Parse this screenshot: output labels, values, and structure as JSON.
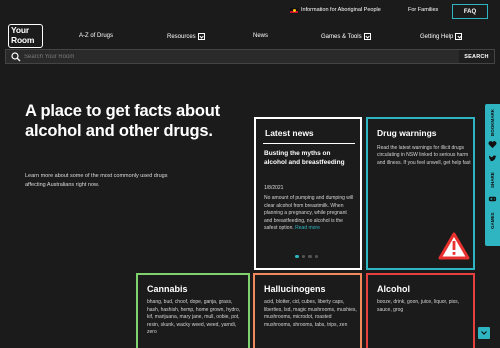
{
  "topbar": {
    "aboriginal_link": "Information for Aboriginal People",
    "families_link": "For Families",
    "faq_label": "FAQ"
  },
  "logo": {
    "line1": "Your",
    "line2": "Room"
  },
  "nav": {
    "items": [
      {
        "label": "A-Z of Drugs",
        "has_dropdown": false
      },
      {
        "label": "Resources",
        "has_dropdown": true
      },
      {
        "label": "News",
        "has_dropdown": false
      },
      {
        "label": "Games & Tools",
        "has_dropdown": true
      },
      {
        "label": "Getting Help",
        "has_dropdown": true
      }
    ]
  },
  "search": {
    "placeholder": "Search Your Room",
    "button_label": "SEARCH",
    "value": ""
  },
  "hero": {
    "title": "A place to get facts about alcohol and other drugs.",
    "subtitle": "Learn more about some of the most commonly used drugs affecting Australians right now."
  },
  "latest_news": {
    "title": "Latest news",
    "headline": "Busting the myths on alcohol and breastfeeding",
    "date": "1/8/2021",
    "body": "No amount of pumping and dumping will clear alcohol from breastmilk. When planning a pregnancy, while pregnant and breastfeeding, no alcohol is the safest option.",
    "read_more": "Read more",
    "slides": 4,
    "active_slide": 1
  },
  "drug_warnings": {
    "title": "Drug warnings",
    "body": "Read the latest warnings for illicit drugs circulating in NSW linked to serious harm and illness. If you feel unwell, get help fast",
    "icon": "warning-triangle-icon"
  },
  "categories": {
    "cannabis": {
      "title": "Cannabis",
      "body": "bhang, bud, choof, dope, ganja, grass, hash, hashish, hemp, home grown, hydro, kif, marijuana, mary jane, mull, oobie, pot, resin, skunk, wacky weed, weed, yarndi, zero"
    },
    "hallucinogens": {
      "title": "Hallucinogens",
      "body": "acid, blotter, cid, cubes, liberty caps, liberties, lsd, magic mushrooms, mushies, mushrooms, microdot, roasted mushrooms, shrooms, tabs, trips, zen"
    },
    "alcohol": {
      "title": "Alcohol",
      "body": "booze, drink, goon, juice, liquor, piss, sauce, grog"
    }
  },
  "sidebar": {
    "bookmark_label": "BOOKMARK",
    "share_label": "SHARE",
    "games_label": "GAMES"
  },
  "colors": {
    "background": "#1b1b1b",
    "accent": "#2fb5c2",
    "cannabis_border": "#7ed16c",
    "hallucinogens_border": "#f08a5d",
    "alcohol_border": "#e44040",
    "news_border": "#ffffff"
  }
}
